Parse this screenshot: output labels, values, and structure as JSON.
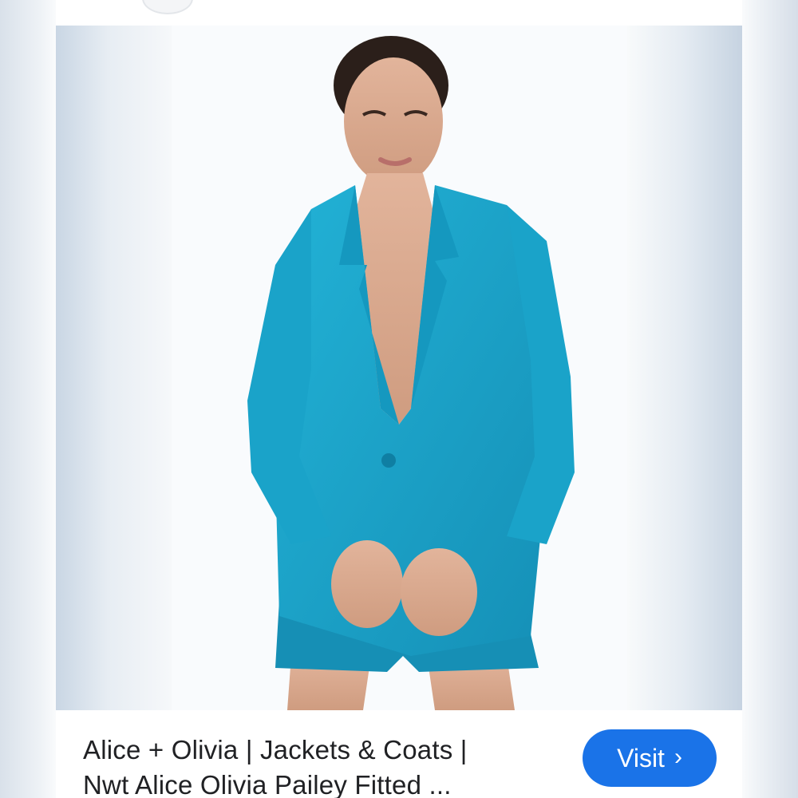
{
  "result": {
    "caption_line1": "Alice + Olivia | Jackets & Coats |",
    "caption_line2": "Nwt Alice Olivia Pailey Fitted ...",
    "visit_label": "Visit",
    "visit_chevron": "›"
  },
  "image": {
    "subject": "model-in-teal-blazer-photo",
    "blazer_color": "#1aa3c9",
    "skin_color": "#d9a98e",
    "hair_color": "#2b1f1a"
  },
  "colors": {
    "accent": "#1a73e8",
    "text": "#202124"
  }
}
